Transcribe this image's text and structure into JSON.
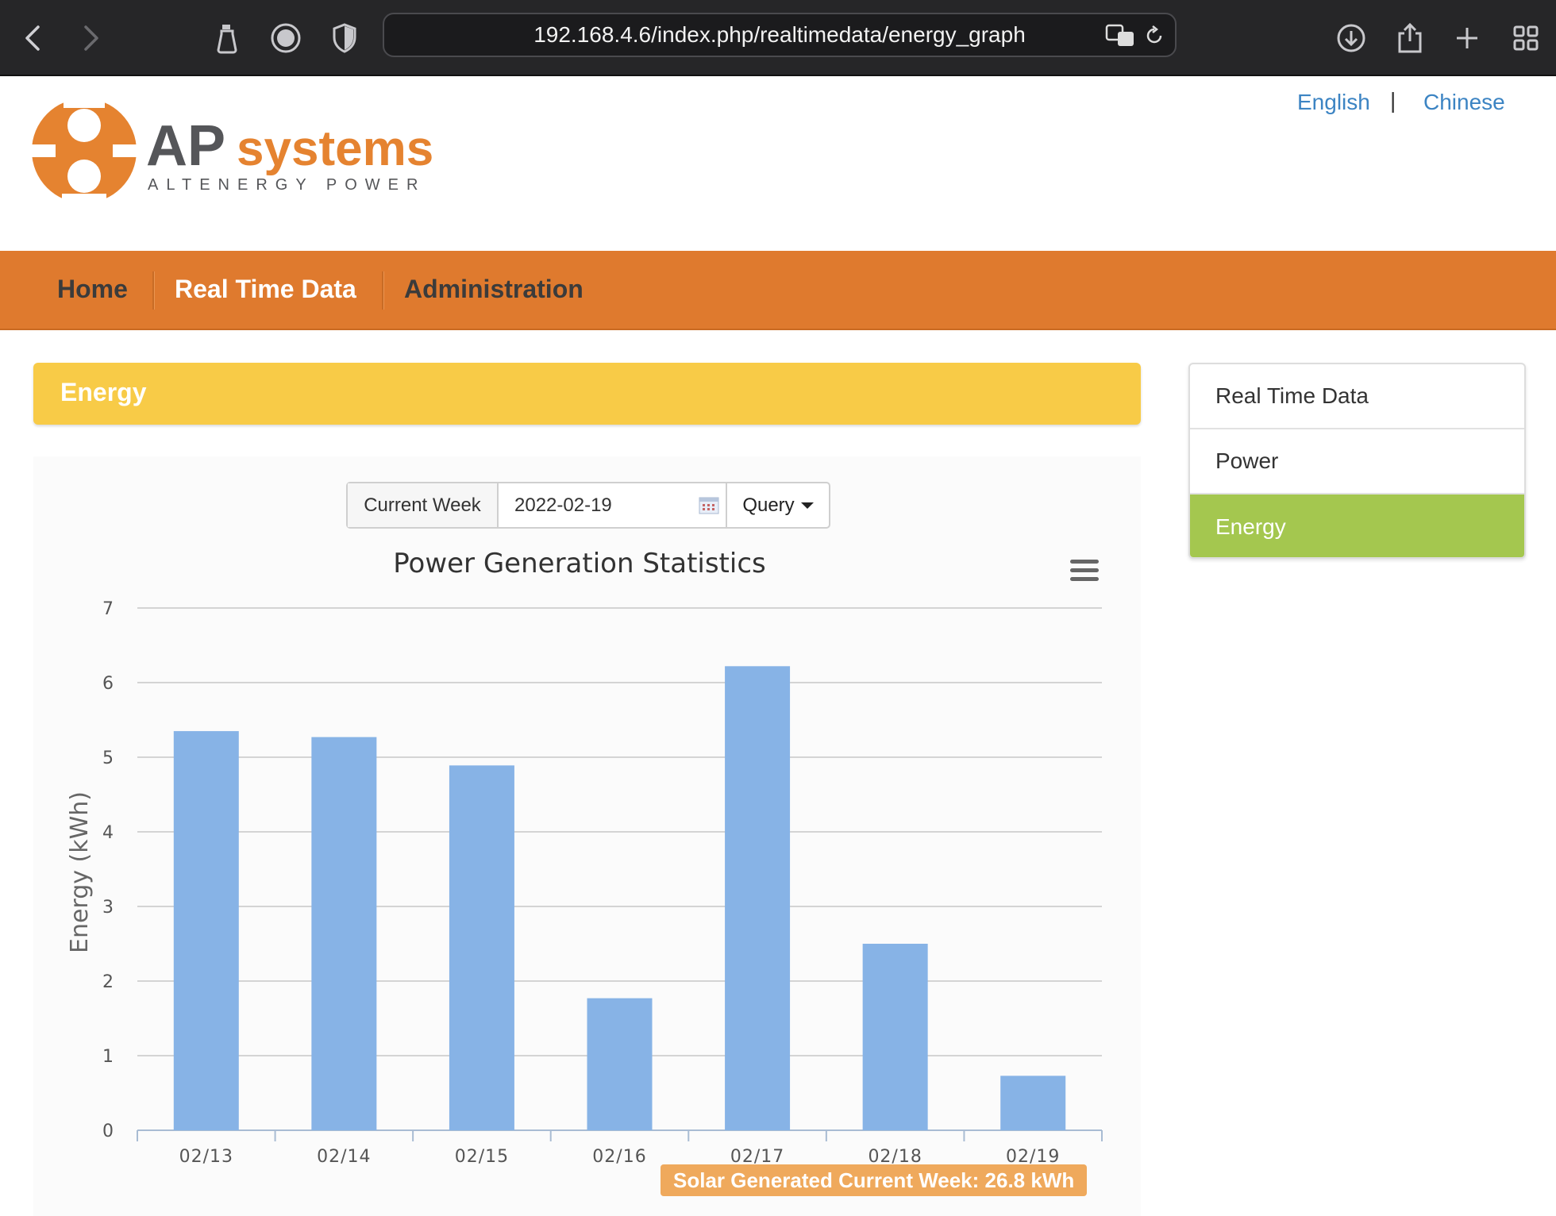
{
  "browser": {
    "url": "192.168.4.6/index.php/realtimedata/energy_graph"
  },
  "header": {
    "logo_brand_ap": "AP",
    "logo_brand_systems": "systems",
    "logo_tagline": "ALTENERGY POWER",
    "languages": [
      "English",
      "Chinese"
    ],
    "language_separator": "|"
  },
  "nav": {
    "items": [
      {
        "label": "Home",
        "active": false
      },
      {
        "label": "Real Time Data",
        "active": true
      },
      {
        "label": "Administration",
        "active": false
      }
    ]
  },
  "panel": {
    "title": "Energy"
  },
  "query": {
    "period_label": "Current Week",
    "date_value": "2022-02-19",
    "button_label": "Query"
  },
  "chart_data": {
    "type": "bar",
    "title": "Power Generation Statistics",
    "ylabel": "Energy (kWh)",
    "xlabel": "",
    "categories": [
      "02/13",
      "02/14",
      "02/15",
      "02/16",
      "02/17",
      "02/18",
      "02/19"
    ],
    "values": [
      5.35,
      5.27,
      4.89,
      1.77,
      6.22,
      2.5,
      0.73
    ],
    "ylim": [
      0,
      7
    ],
    "yticks": [
      "0",
      "1",
      "2",
      "3",
      "4",
      "5",
      "6",
      "7"
    ],
    "grid": true,
    "legend": "none",
    "bar_color": "#87b3e6"
  },
  "summary": {
    "text": "Solar Generated Current Week: 26.8 kWh"
  },
  "side_menu": {
    "items": [
      {
        "label": "Real Time Data",
        "active": false
      },
      {
        "label": "Power",
        "active": false
      },
      {
        "label": "Energy",
        "active": true
      }
    ]
  },
  "colors": {
    "brand_orange": "#df7a2e",
    "panel_yellow": "#f8cb47",
    "active_green": "#a4c74f",
    "link_blue": "#3c84c3"
  }
}
